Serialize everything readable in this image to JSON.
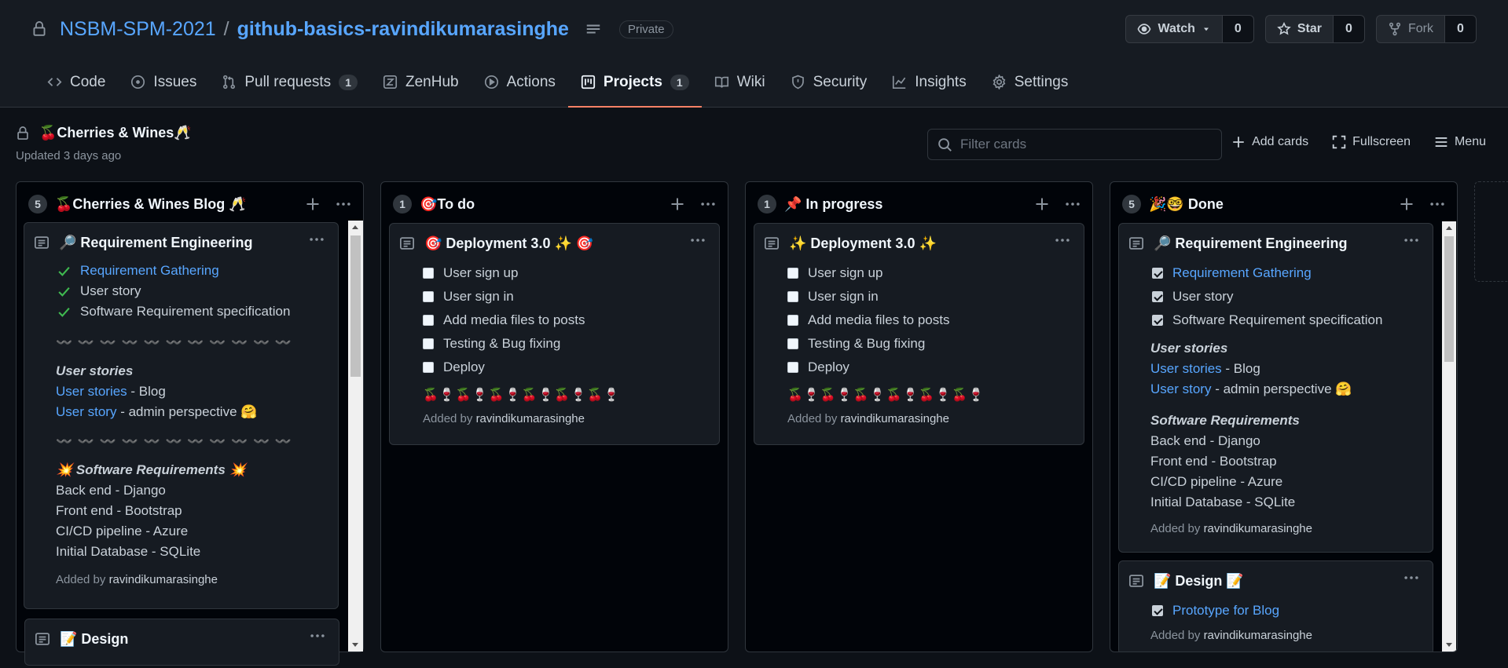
{
  "repo": {
    "owner": "NSBM-SPM-2021",
    "separator": "/",
    "name": "github-basics-ravindikumarasinghe",
    "visibility": "Private",
    "watch_label": "Watch",
    "watch_count": "0",
    "star_label": "Star",
    "star_count": "0",
    "fork_label": "Fork",
    "fork_count": "0"
  },
  "tabs": [
    {
      "label": "Code",
      "icon": "code-icon"
    },
    {
      "label": "Issues",
      "icon": "issue-icon"
    },
    {
      "label": "Pull requests",
      "icon": "pull-request-icon",
      "count": "1"
    },
    {
      "label": "ZenHub",
      "icon": "zenhub-icon"
    },
    {
      "label": "Actions",
      "icon": "play-icon"
    },
    {
      "label": "Projects",
      "icon": "project-icon",
      "count": "1",
      "active": true
    },
    {
      "label": "Wiki",
      "icon": "book-icon"
    },
    {
      "label": "Security",
      "icon": "shield-icon"
    },
    {
      "label": "Insights",
      "icon": "graph-icon"
    },
    {
      "label": "Settings",
      "icon": "gear-icon"
    }
  ],
  "project": {
    "title": "🍒Cherries & Wines🥂",
    "updated": "Updated 3 days ago",
    "filter_placeholder": "Filter cards",
    "add_cards": "Add cards",
    "fullscreen": "Fullscreen",
    "menu": "Menu"
  },
  "columns": [
    {
      "count": "5",
      "name": "🍒Cherries & Wines Blog 🥂",
      "cards": [
        {
          "title": "🔎 Requirement Engineering",
          "checks": [
            "Requirement Gathering",
            "User story",
            "Software Requirement specification"
          ],
          "wave": "〰️ 〰️ 〰️ 〰️ 〰️ 〰️ 〰️ 〰️ 〰️ 〰️ 〰️",
          "stories_heading": "User stories",
          "story1_link": "User stories",
          "story1_rest": " - Blog",
          "story2_link": "User story",
          "story2_rest": " - admin perspective 🤗",
          "req_heading": "💥 Software Requirements 💥",
          "reqs": [
            "Back end - Django",
            "Front end - Bootstrap",
            "CI/CD pipeline - Azure",
            "Initial Database - SQLite"
          ],
          "added_by": "Added by",
          "author": "ravindikumarasinghe"
        },
        {
          "title": "📝 Design"
        }
      ]
    },
    {
      "count": "1",
      "name": "🎯To do",
      "cards": [
        {
          "title": "🎯 Deployment 3.0 ✨ 🎯",
          "tasks": [
            "User sign up",
            "User sign in",
            "Add media files to posts",
            "Testing & Bug fixing",
            "Deploy"
          ],
          "emoji": "🍒🍷🍒🍷🍒🍷🍒🍷🍒🍷🍒🍷",
          "added_by": "Added by",
          "author": "ravindikumarasinghe"
        }
      ]
    },
    {
      "count": "1",
      "name": "📌 In progress",
      "cards": [
        {
          "title": "✨ Deployment 3.0 ✨",
          "tasks": [
            "User sign up",
            "User sign in",
            "Add media files to posts",
            "Testing & Bug fixing",
            "Deploy"
          ],
          "emoji": "🍒🍷🍒🍷🍒🍷🍒🍷🍒🍷🍒🍷",
          "added_by": "Added by",
          "author": "ravindikumarasinghe"
        }
      ]
    },
    {
      "count": "5",
      "name": "🎉🤓 Done",
      "cards": [
        {
          "title": "🔎 Requirement Engineering",
          "checks": [
            "Requirement Gathering",
            "User story",
            "Software Requirement specification"
          ],
          "stories_heading": "User stories",
          "story1_link": "User stories",
          "story1_rest": " - Blog",
          "story2_link": "User story",
          "story2_rest": " - admin perspective 🤗",
          "req_heading": "Software Requirements",
          "reqs": [
            "Back end - Django",
            "Front end - Bootstrap",
            "CI/CD pipeline - Azure",
            "Initial Database - SQLite"
          ],
          "added_by": "Added by",
          "author": "ravindikumarasinghe"
        },
        {
          "title": "📝 Design 📝",
          "checks": [
            "Prototype for Blog"
          ],
          "added_by": "Added by",
          "author": "ravindikumarasinghe"
        }
      ]
    }
  ],
  "colors": {
    "background": "#0d1117",
    "header": "#161b22",
    "link": "#58a6ff",
    "active_tab_underline": "#f78166",
    "check_green": "#3fb950"
  }
}
